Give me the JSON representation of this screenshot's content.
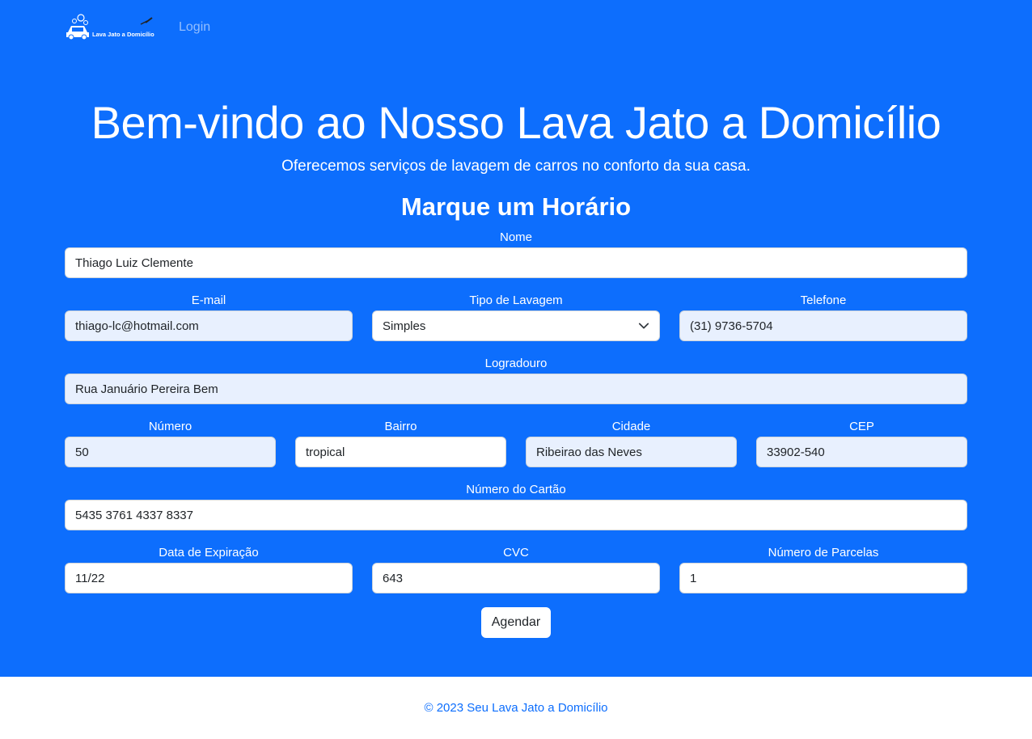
{
  "nav": {
    "brand_text": "Lava Jato a Domicílio",
    "login_label": "Login"
  },
  "hero": {
    "title": "Bem-vindo ao Nosso Lava Jato a Domicílio",
    "subtitle": "Oferecemos serviços de lavagem de carros no conforto da sua casa."
  },
  "form": {
    "title": "Marque um Horário",
    "fields": {
      "nome": {
        "label": "Nome",
        "value": "Thiago Luiz Clemente"
      },
      "email": {
        "label": "E-mail",
        "value": "thiago-lc@hotmail.com"
      },
      "tipo": {
        "label": "Tipo de Lavagem",
        "value": "Simples"
      },
      "telefone": {
        "label": "Telefone",
        "value": "(31) 9736-5704"
      },
      "logradouro": {
        "label": "Logradouro",
        "value": "Rua Januário Pereira Bem"
      },
      "numero": {
        "label": "Número",
        "value": "50"
      },
      "bairro": {
        "label": "Bairro",
        "value": "tropical"
      },
      "cidade": {
        "label": "Cidade",
        "value": "Ribeirao das Neves"
      },
      "cep": {
        "label": "CEP",
        "value": "33902-540"
      },
      "cartao": {
        "label": "Número do Cartão",
        "value": "5435 3761 4337 8337"
      },
      "expiracao": {
        "label": "Data de Expiração",
        "value": "11/22"
      },
      "cvc": {
        "label": "CVC",
        "value": "643"
      },
      "parcelas": {
        "label": "Número de Parcelas",
        "value": "1"
      }
    },
    "submit_label": "Agendar"
  },
  "footer": {
    "text": "© 2023 Seu Lava Jato a Domicílio"
  },
  "colors": {
    "primary": "#0d6efd",
    "autofill": "#e8f0fe",
    "white": "#ffffff"
  }
}
